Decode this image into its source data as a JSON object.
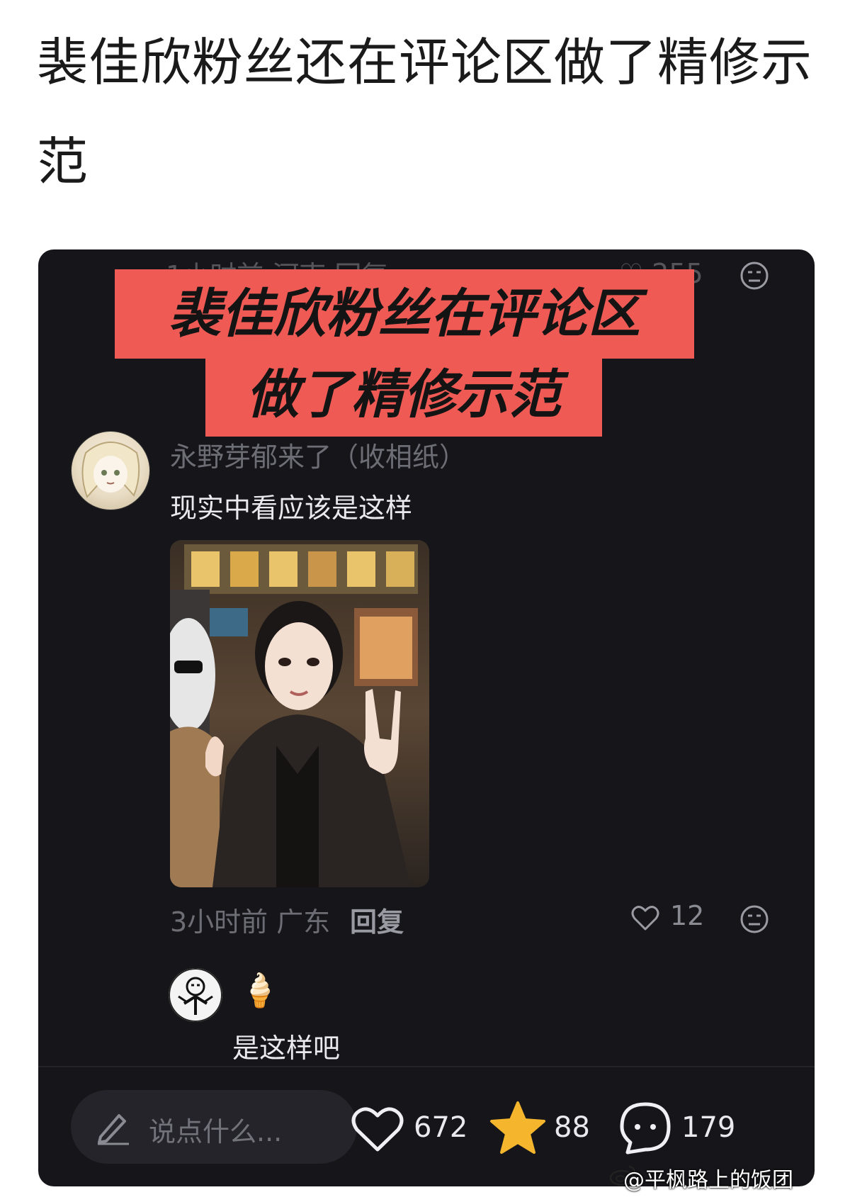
{
  "post": {
    "title": "裴佳欣粉丝还在评论区做了精修示范"
  },
  "card": {
    "ghost_meta": "1小时前 河南 回复",
    "ghost_like_count": "255",
    "banner_line1": "裴佳欣粉丝在评论区",
    "banner_line2": "做了精修示范",
    "comment": {
      "username": "永野芽郁来了（收相纸）",
      "text": "现实中看应该是这样",
      "time_location": "3小时前 广东",
      "reply_label": "回复",
      "like_count": "12"
    },
    "sub_comment": {
      "emoji": "🍦",
      "text": "是这样吧"
    },
    "bottom_bar": {
      "input_placeholder": "说点什么...",
      "likes": "672",
      "favorites": "88",
      "comments": "179"
    }
  },
  "watermark": "@平枫路上的饭团",
  "colors": {
    "banner": "#f05a55",
    "card_bg": "#16161a",
    "star": "#f5b62e"
  }
}
